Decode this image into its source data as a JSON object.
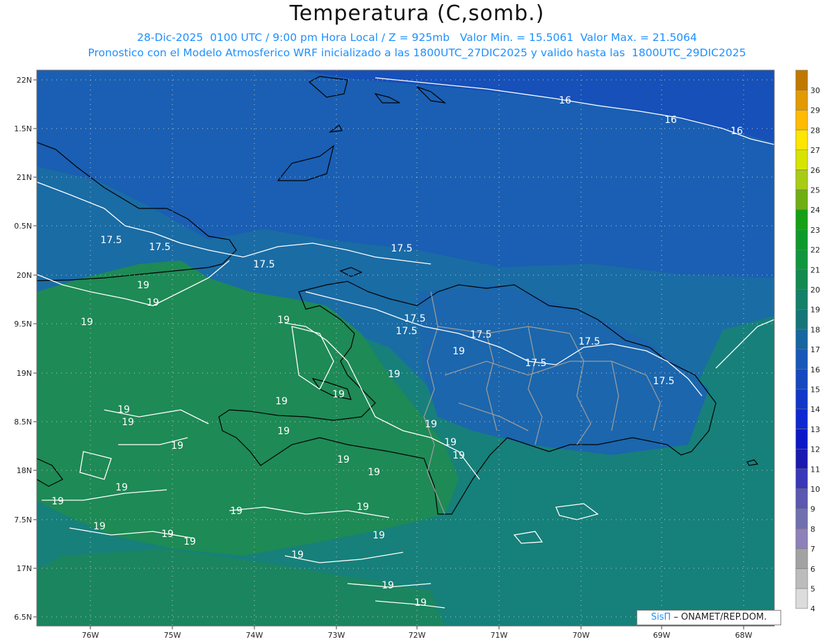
{
  "header": {
    "title": "Temperatura (C,somb.)",
    "line1": "28-Dic-2025  0100 UTC / 9:00 pm Hora Local / Z = 925mb   Valor Min. = 15.5061  Valor Max. = 21.5064",
    "line2": "Pronostico con el Modelo Atmosferico WRF inicializado a las 1800UTC_27DIC2025 y valido hasta las  1800UTC_29DIC2025"
  },
  "map": {
    "lat_labels": [
      "22N",
      "1.5N",
      "21N",
      "0.5N",
      "20N",
      "9.5N",
      "19N",
      "8.5N",
      "18N",
      "7.5N",
      "17N",
      "6.5N"
    ],
    "lon_labels": [
      "76W",
      "75W",
      "74W",
      "73W",
      "72W",
      "71W",
      "70W",
      "69W",
      "68W"
    ],
    "contour_labels": [
      "16",
      "16",
      "16",
      "17.5",
      "17.5",
      "17.5",
      "17.5",
      "17.5",
      "17.5",
      "17.5",
      "17.5",
      "17.5",
      "17.5",
      "19",
      "19",
      "19",
      "19",
      "19",
      "19",
      "19",
      "19",
      "19",
      "19",
      "19",
      "19",
      "19",
      "19",
      "19",
      "19",
      "19",
      "19",
      "19",
      "19",
      "19",
      "19",
      "19",
      "19",
      "19",
      "19",
      "19",
      "19"
    ],
    "colors": {
      "cold_blue": "#1750b8",
      "mid_blue": "#1b6cb0",
      "teal": "#17807a",
      "green": "#1e8a55"
    }
  },
  "colorbar": {
    "labels": [
      "30",
      "29",
      "28",
      "27",
      "26",
      "25",
      "24",
      "23",
      "22",
      "21",
      "20",
      "19",
      "18",
      "17",
      "16",
      "15",
      "14",
      "13",
      "12",
      "11",
      "10",
      "9",
      "8",
      "7",
      "6",
      "5",
      "4"
    ],
    "colors": [
      "#c07800",
      "#e39a00",
      "#ffbb00",
      "#ffe600",
      "#d8e400",
      "#a8cc14",
      "#6fae12",
      "#15a015",
      "#0e9a2a",
      "#10963e",
      "#128a50",
      "#138068",
      "#147678",
      "#1666a0",
      "#1858b8",
      "#1548c0",
      "#1238c8",
      "#0f28d2",
      "#0c18c8",
      "#1a1ab0",
      "#3838b8",
      "#5a58b0",
      "#7070b0",
      "#8e80b8",
      "#a2a2a2",
      "#bcbcbc",
      "#dcdcdc"
    ]
  },
  "credit": {
    "brand": "SisΠ",
    "text": " – ONAMET/REP.DOM."
  }
}
